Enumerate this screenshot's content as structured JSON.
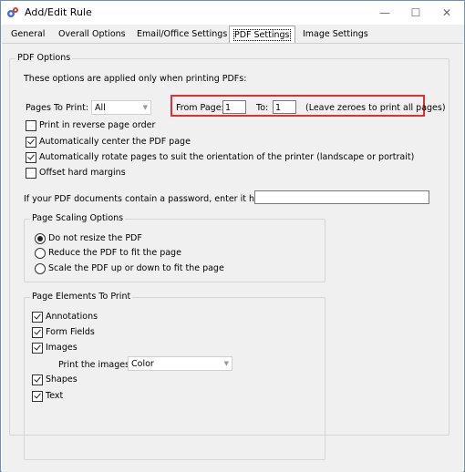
{
  "window": {
    "title": "Add/Edit Rule",
    "minimize": "—",
    "maximize": "☐",
    "close": "✕"
  },
  "tabs": [
    {
      "label": "General"
    },
    {
      "label": "Overall Options"
    },
    {
      "label": "Email/Office Settings"
    },
    {
      "label": "PDF Settings"
    },
    {
      "label": "Image Settings"
    }
  ],
  "pdf_options": {
    "group_title": "PDF Options",
    "intro": "These options are applied only when printing PDFs:",
    "pages_to_print_label": "Pages To Print:",
    "pages_to_print_value": "All",
    "from_page_label": "From Page:",
    "from_page_value": "1",
    "to_label": "To:",
    "to_value": "1",
    "zeros_hint": "(Leave zeroes to print all pages)",
    "reverse_order": {
      "label": "Print in reverse page order",
      "checked": false
    },
    "auto_center": {
      "label": "Automatically center the PDF page",
      "checked": true
    },
    "auto_rotate": {
      "label": "Automatically rotate pages to suit the orientation of the printer (landscape or portrait)",
      "checked": true
    },
    "offset_margins": {
      "label": "Offset hard margins",
      "checked": false
    },
    "password_label": "If your PDF documents contain a password, enter it here:",
    "password_value": ""
  },
  "page_scaling": {
    "group_title": "Page Scaling Options",
    "options": [
      {
        "label": "Do not resize the PDF",
        "selected": true
      },
      {
        "label": "Reduce the PDF to fit the page",
        "selected": false
      },
      {
        "label": "Scale the PDF up or down to fit the page",
        "selected": false
      }
    ]
  },
  "page_elements": {
    "group_title": "Page Elements To Print",
    "annotations": {
      "label": "Annotations",
      "checked": true
    },
    "form_fields": {
      "label": "Form Fields",
      "checked": true
    },
    "images": {
      "label": "Images",
      "checked": true
    },
    "images_in_label": "Print the images in",
    "images_in_value": "Color",
    "shapes": {
      "label": "Shapes",
      "checked": true
    },
    "text": {
      "label": "Text",
      "checked": true
    }
  },
  "colors": {
    "highlight": "#e03030",
    "accent": "#0078d7"
  }
}
